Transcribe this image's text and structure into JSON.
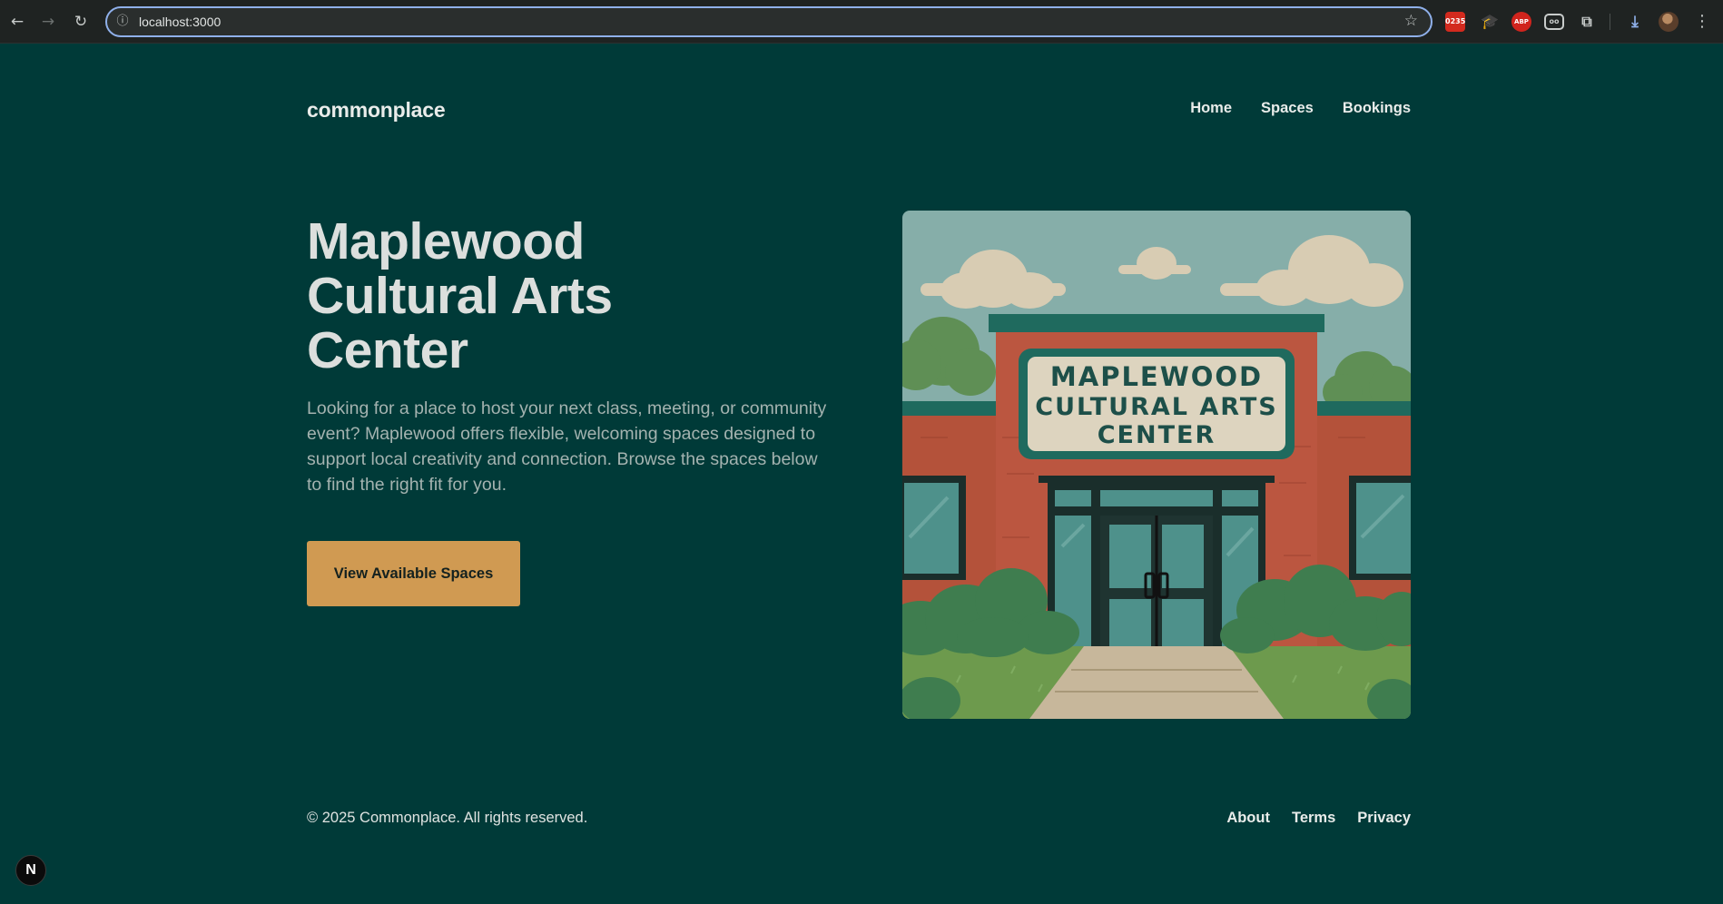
{
  "browser": {
    "url": "localhost:3000",
    "extension_badge": "0235",
    "abp_label": "ABP",
    "ext4_label": "oo"
  },
  "site": {
    "brand": "commonplace",
    "nav": [
      {
        "label": "Home"
      },
      {
        "label": "Spaces"
      },
      {
        "label": "Bookings"
      }
    ]
  },
  "hero": {
    "title_lines": [
      "Maplewood",
      "Cultural Arts",
      "Center"
    ],
    "description": "Looking for a place to host your next class, meeting, or community event? Maplewood offers flexible, welcoming spaces designed to support local creativity and connection. Browse the spaces below to find the right fit for you.",
    "cta_label": "View Available Spaces",
    "image": {
      "sign_lines": [
        "MAPLEWOOD",
        "CULTURAL ARTS",
        "CENTER"
      ]
    }
  },
  "footer": {
    "copyright": "© 2025 Commonplace. All rights reserved.",
    "links": [
      {
        "label": "About"
      },
      {
        "label": "Terms"
      },
      {
        "label": "Privacy"
      }
    ]
  },
  "dev_badge": "N",
  "colors": {
    "page_bg": "#003a38",
    "accent": "#d09a52",
    "text_light": "#dcdfdd",
    "text_muted": "#a4b3b0"
  }
}
